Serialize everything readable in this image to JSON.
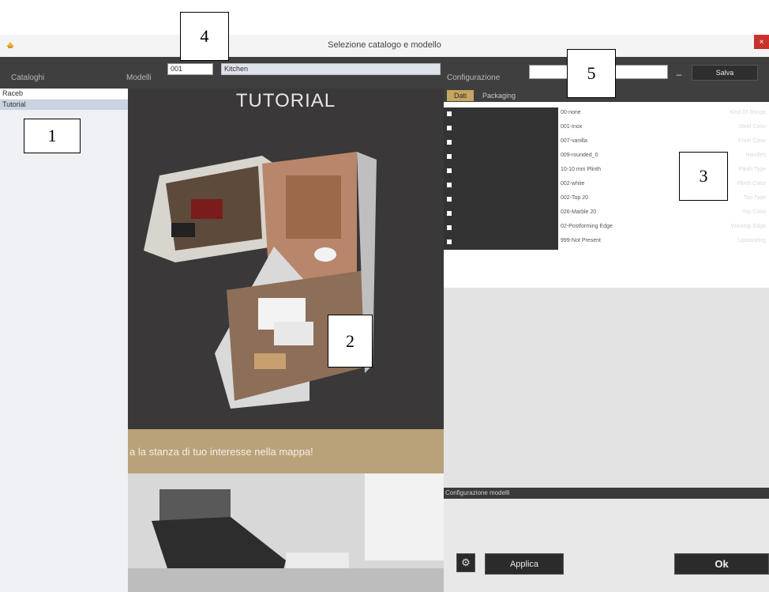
{
  "window": {
    "title": "Selezione catalogo e modello",
    "close_label": "×"
  },
  "header": {
    "cataloghi_label": "Cataloghi",
    "modelli_label": "Modelli",
    "model_code": "001",
    "model_name": "Kitchen",
    "configurazione_label": "Configurazione",
    "config_value": "",
    "minus_label": "–",
    "salva_label": "Salva"
  },
  "catalogs": [
    "Raceb",
    "Tutorial"
  ],
  "preview": {
    "title": "TUTORIAL",
    "banner_text": "a la stanza di tuo interesse nella mappa!"
  },
  "tabs": [
    "Dati",
    "Packaging"
  ],
  "properties": [
    {
      "name": "Kind Of Range",
      "value": "00-none"
    },
    {
      "name": "Steel Color",
      "value": "001-Inox"
    },
    {
      "name": "Front Color",
      "value": "007-vanilla"
    },
    {
      "name": "Handles",
      "value": "009-rounded_0"
    },
    {
      "name": "Plinth Type",
      "value": "10-10 mm Plinth"
    },
    {
      "name": "Plinth Color",
      "value": "002-white"
    },
    {
      "name": "Top Type",
      "value": "002-Top 20"
    },
    {
      "name": "Top Color",
      "value": "026-Marble 20"
    },
    {
      "name": "Worktop Edge",
      "value": "02-Postforming Edge"
    },
    {
      "name": "Upstanding",
      "value": "999-Not Present"
    }
  ],
  "footer": {
    "config_label": "Configurazione modelli",
    "applica_label": "Applica",
    "ok_label": "Ok",
    "gear_glyph": "⚙"
  },
  "callouts": [
    "1",
    "2",
    "3",
    "4",
    "5"
  ],
  "colors": {
    "accent": "#c6a560",
    "dark": "#3f3f3f",
    "banner": "#b9a17a"
  }
}
